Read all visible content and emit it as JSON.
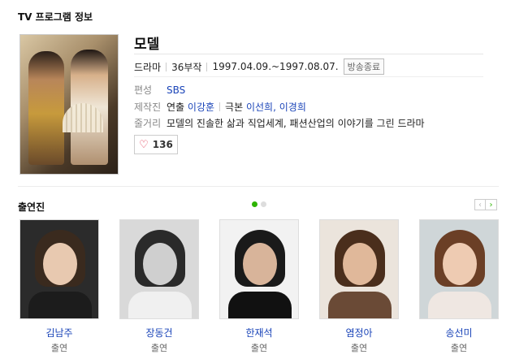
{
  "section_title": "TV 프로그램 정보",
  "program": {
    "title": "모델",
    "genre": "드라마",
    "episodes": "36부작",
    "period": "1997.04.09.~1997.08.07.",
    "status": "방송종료",
    "broadcaster_label": "편성",
    "broadcaster": "SBS",
    "staff_label": "제작진",
    "director_label": "연출",
    "director": "이강훈",
    "writer_label": "극본",
    "writer1": "이선희",
    "writer_comma": ",",
    "writer2": "이경희",
    "synopsis_label": "줄거리",
    "synopsis": "모델의 진솔한 삶과 직업세계, 패션산업의 이야기를 그린 드라마",
    "likes": "136"
  },
  "cast": {
    "title": "출연진",
    "members": [
      {
        "name": "김남주",
        "role": "출연",
        "bg": "#2b2b2b",
        "hair": "#3a2a1e",
        "face": "#e8c9b0",
        "body": "#1c1c1c"
      },
      {
        "name": "장동건",
        "role": "출연",
        "bg": "#d9d9d9",
        "hair": "#2a2a2a",
        "face": "#cfcfcf",
        "body": "#f0f0f0"
      },
      {
        "name": "한재석",
        "role": "출연",
        "bg": "#f2f2f2",
        "hair": "#1a1a1a",
        "face": "#d8b49a",
        "body": "#111111"
      },
      {
        "name": "염정아",
        "role": "출연",
        "bg": "#ebe4dc",
        "hair": "#4a2e1c",
        "face": "#e0b89a",
        "body": "#6a4a36"
      },
      {
        "name": "송선미",
        "role": "출연",
        "bg": "#cfd6d8",
        "hair": "#6b3f26",
        "face": "#eecbb2",
        "body": "#efe7e2"
      }
    ]
  }
}
